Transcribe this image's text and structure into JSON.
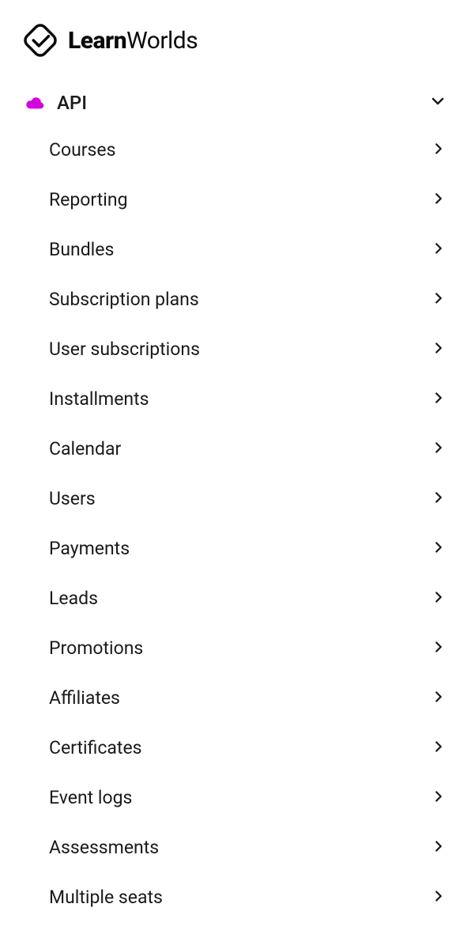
{
  "brand": {
    "name_bold": "Learn",
    "name_light": "Worlds"
  },
  "nav": {
    "root": {
      "label": "API",
      "icon": "cloud"
    },
    "items": [
      {
        "label": "Courses"
      },
      {
        "label": "Reporting"
      },
      {
        "label": "Bundles"
      },
      {
        "label": "Subscription plans"
      },
      {
        "label": "User subscriptions"
      },
      {
        "label": "Installments"
      },
      {
        "label": "Calendar"
      },
      {
        "label": "Users"
      },
      {
        "label": "Payments"
      },
      {
        "label": "Leads"
      },
      {
        "label": "Promotions"
      },
      {
        "label": "Affiliates"
      },
      {
        "label": "Certificates"
      },
      {
        "label": "Event logs"
      },
      {
        "label": "Assessments"
      },
      {
        "label": "Multiple seats"
      }
    ]
  },
  "colors": {
    "accent": "#d400e0",
    "text": "#1a1a1a"
  }
}
